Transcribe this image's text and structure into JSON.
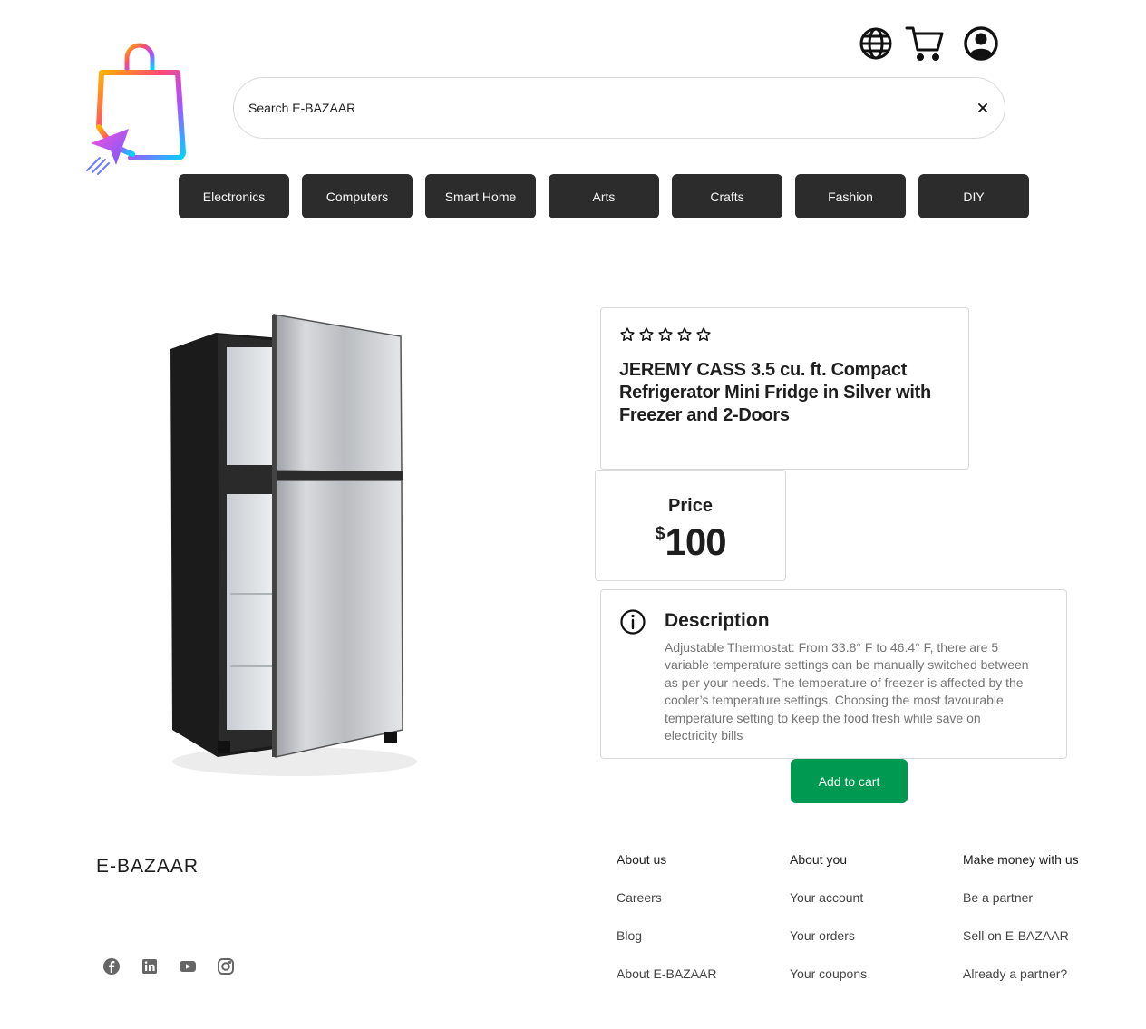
{
  "header": {
    "search_placeholder": "Search E-BAZAAR",
    "categories": [
      "Electronics",
      "Computers",
      "Smart Home",
      "Arts",
      "Crafts",
      "Fashion",
      "DIY"
    ],
    "icons": [
      "globe-icon",
      "cart-icon",
      "account-icon",
      "close-icon"
    ]
  },
  "product": {
    "rating": 0,
    "rating_max": 5,
    "title": "JEREMY CASS 3.5 cu. ft. Compact Refrigerator Mini Fridge in Silver with Freezer and 2-Doors",
    "price_label": "Price",
    "currency": "$",
    "price": "100",
    "description_title": "Description",
    "description": "Adjustable Thermostat: From 33.8° F to 46.4° F, there are 5 variable temperature settings can be manually switched between as per your needs. The temperature of freezer is affected by the cooler’s temperature settings. Choosing the most favourable temperature setting to keep the food fresh while save on electricity bills",
    "add_to_cart": "Add to cart"
  },
  "footer": {
    "brand": "E-BAZAAR",
    "social": [
      "facebook-icon",
      "linkedin-icon",
      "youtube-icon",
      "instagram-icon"
    ],
    "columns": [
      {
        "heading": "About us",
        "links": [
          "Careers",
          "Blog",
          "About E-BAZAAR"
        ]
      },
      {
        "heading": "About you",
        "links": [
          "Your account",
          "Your orders",
          "Your coupons"
        ]
      },
      {
        "heading": "Make money with us",
        "links": [
          "Be a partner",
          "Sell on E-BAZAAR",
          "Already a partner?"
        ]
      }
    ]
  },
  "colors": {
    "category_bg": "#2c2c2c",
    "cta_green": "#009951",
    "border": "#d9d9d9",
    "muted_text": "#757575"
  }
}
